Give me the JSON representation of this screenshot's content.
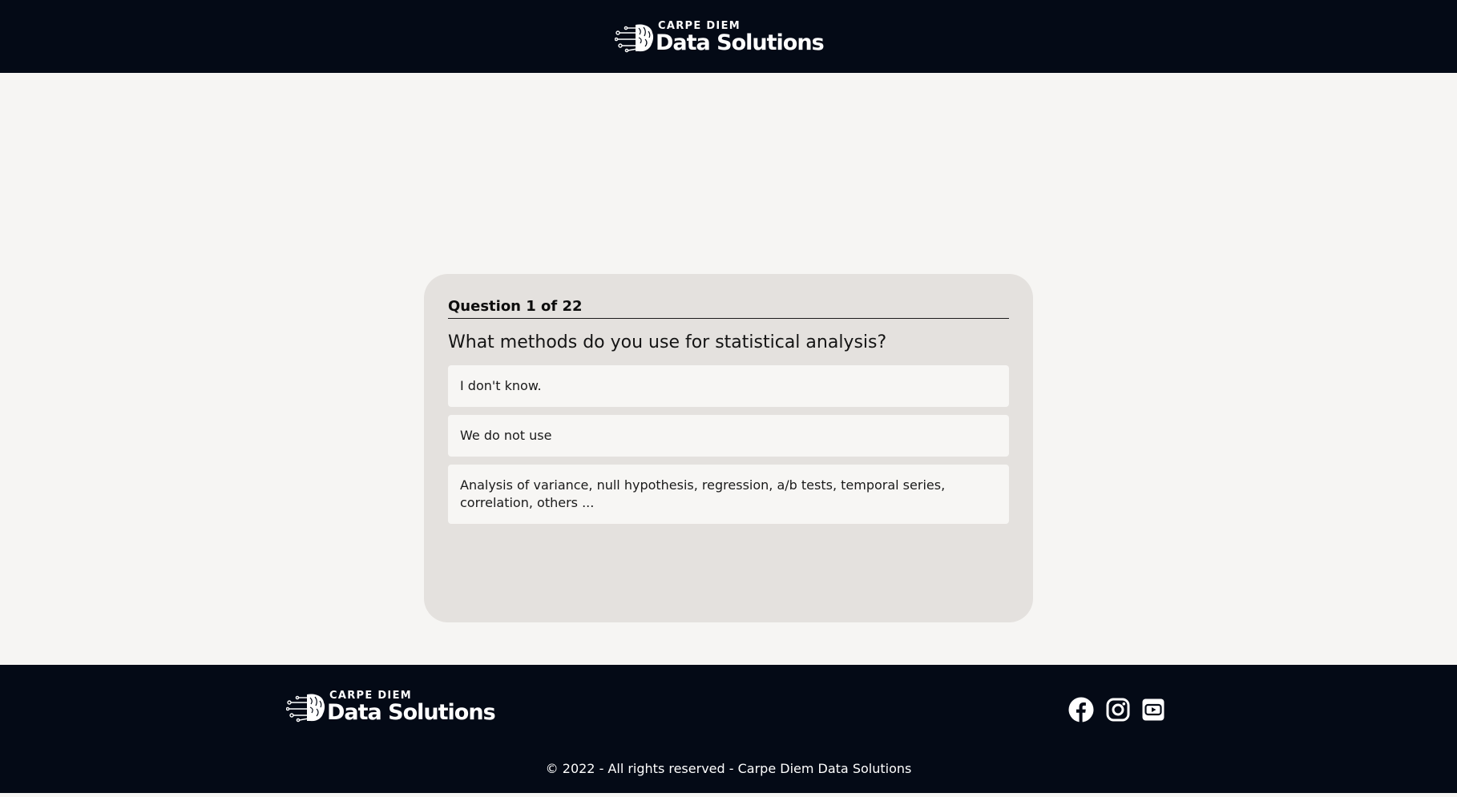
{
  "brand": {
    "small": "CARPE DIEM",
    "big": "Data Solutions"
  },
  "quiz": {
    "counter": "Question 1 of 22",
    "question": "What methods do you use for statistical analysis?",
    "options": [
      "I don't know.",
      "We do not use",
      "Analysis of variance, null hypothesis, regression, a/b tests, temporal series, correlation, others ..."
    ]
  },
  "footer": {
    "social": [
      "facebook-icon",
      "instagram-icon",
      "youtube-icon"
    ],
    "copyright": "© 2022 - All rights reserved - Carpe Diem Data Solutions"
  },
  "colors": {
    "dark": "#040a16",
    "page": "#f6f5f3",
    "card": "#e4e1de"
  }
}
